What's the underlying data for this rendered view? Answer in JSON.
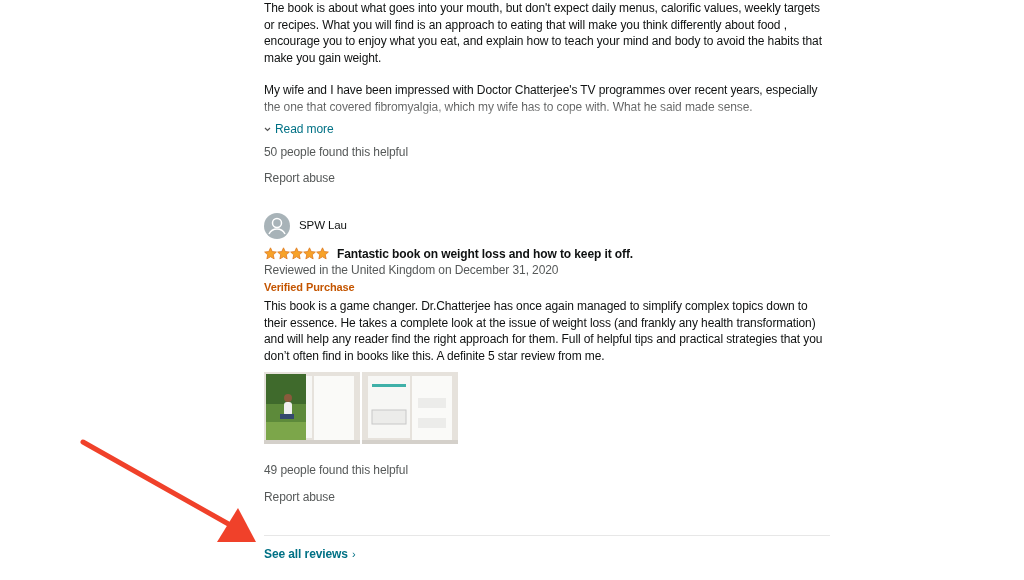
{
  "first_review": {
    "paragraphs": [
      "The book is about what goes into your mouth, but don't expect daily menus, calorific values, weekly targets or recipes. What you will find is an approach to eating that will make you think differently about food , encourage you to enjoy what you eat, and explain how to teach your mind and body to avoid the habits that make you gain weight.",
      "My wife and I have been impressed with Doctor Chatterjee's TV programmes over recent years, especially the one that covered fibromyalgia, which my wife has to cope with. What he said made sense."
    ],
    "read_more": "Read more",
    "expanded": false,
    "helpful": "50 people found this helpful",
    "report": "Report abuse"
  },
  "second_review": {
    "author": "SPW Lau",
    "stars": 5,
    "title": "Fantastic book on weight loss and how to keep it off.",
    "reviewed": "Reviewed in the United Kingdom on December 31, 2020",
    "verified": "Verified Purchase",
    "body": "This book is a game changer. Dr.Chatterjee has once again managed to simplify complex topics down to their essence. He takes a complete look at the issue of weight loss (and frankly any health transformation) and will help any reader find the right approach for them. Full of helpful tips and practical strategies that you don’t often find in books like this. A definite 5 star review from me.",
    "photos": [
      {
        "kind": "picture"
      },
      {
        "kind": "picture"
      }
    ],
    "helpful": "49 people found this helpful",
    "report": "Report abuse"
  },
  "see_all": "See all reviews",
  "see_all_chevron": "›"
}
